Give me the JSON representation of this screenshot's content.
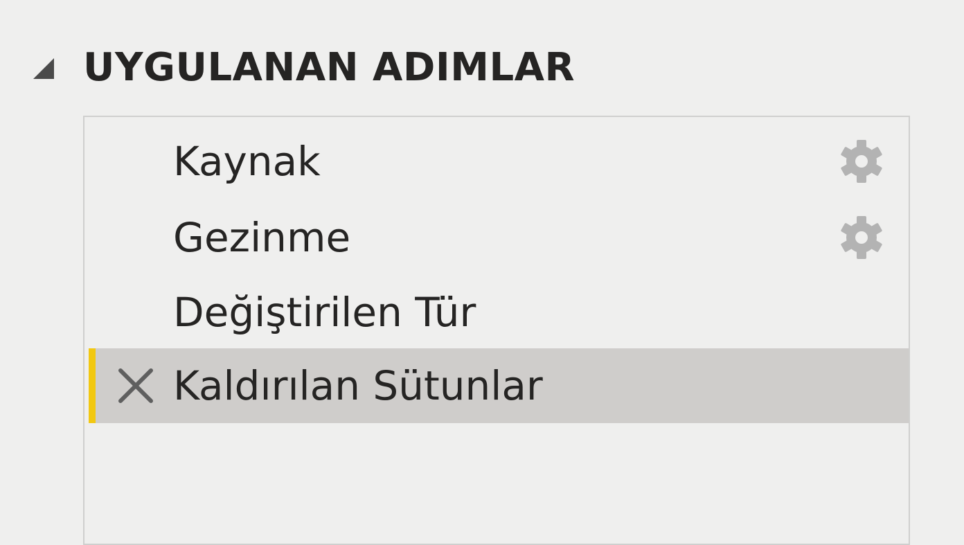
{
  "applied_steps": {
    "title": "UYGULANAN ADIMLAR",
    "toggle_icon": "collapse-triangle-icon",
    "steps": [
      {
        "label": "Kaynak",
        "has_settings": true,
        "settings_icon": "gear-icon"
      },
      {
        "label": "Gezinme",
        "has_settings": true,
        "settings_icon": "gear-icon"
      },
      {
        "label": "Değiştirilen Tür",
        "has_settings": false
      },
      {
        "label": "Kaldırılan Sütunlar",
        "has_settings": false,
        "selected": true,
        "delete_icon": "close-icon"
      }
    ]
  },
  "colors": {
    "background": "#efefee",
    "text": "#252423",
    "selected_row": "#cfcdcb",
    "selection_accent": "#f2c811",
    "icon_gray": "#b3b3b3",
    "panel_border": "#cfcfce"
  }
}
